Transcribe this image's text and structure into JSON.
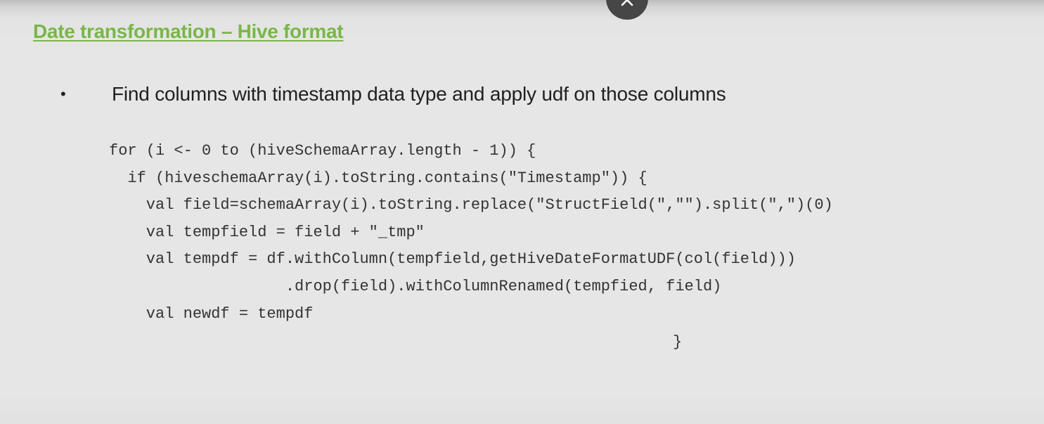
{
  "slide": {
    "title": "Date transformation – Hive format",
    "bullet_symbol": "•",
    "bullet_text": "Find columns with timestamp data type and apply udf on those columns",
    "code_lines": [
      "for (i <- 0 to (hiveSchemaArray.length - 1)) {",
      "  if (hiveschemaArray(i).toString.contains(\"Timestamp\")) {",
      "    val field=schemaArray(i).toString.replace(\"StructField(\",\"\").split(\",\")(0)",
      "    val tempfield = field + \"_tmp\"",
      "    val tempdf = df.withColumn(tempfield,getHiveDateFormatUDF(col(field)))",
      "                   .drop(field).withColumnRenamed(tempfied, field)",
      "    val newdf = tempdf"
    ],
    "closing_brace": "}"
  },
  "overlay": {
    "close_icon": "close-icon"
  }
}
